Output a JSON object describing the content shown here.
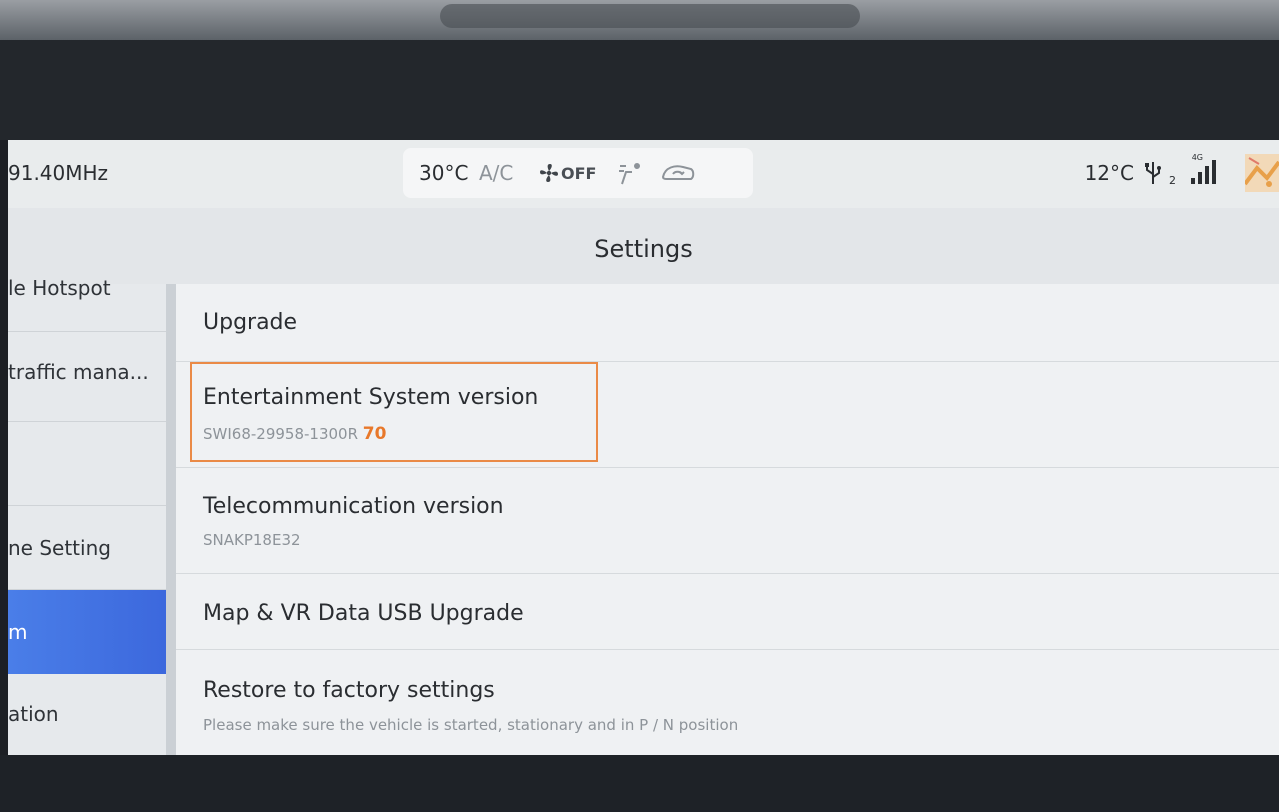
{
  "status_bar": {
    "radio_frequency": "91.40MHz",
    "climate": {
      "cabin_temp": "30°C",
      "ac_label": "A/C",
      "fan_state": "OFF"
    },
    "outside_temp": "12°C",
    "usb_port": "2",
    "network_type": "4G"
  },
  "title_bar": {
    "title": "Settings"
  },
  "sidebar": {
    "items": [
      {
        "label": "le Hotspot"
      },
      {
        "label": "traffic mana..."
      },
      {
        "label": ""
      },
      {
        "label": "ne Setting"
      },
      {
        "label": "m",
        "active": true
      },
      {
        "label": "ation"
      }
    ]
  },
  "settings_list": {
    "rows": [
      {
        "title": "Upgrade",
        "subtitle": ""
      },
      {
        "title": "Entertainment System version",
        "subtitle": "SWI68-29958-1300R",
        "subtitle_highlight": "70"
      },
      {
        "title": "Telecommunication version",
        "subtitle": "SNAKP18E32"
      },
      {
        "title": "Map & VR Data USB Upgrade",
        "subtitle": ""
      },
      {
        "title": "Restore to factory settings",
        "subtitle": "Please make sure the vehicle is started, stationary and in P / N position"
      }
    ]
  },
  "colors": {
    "active_item": "#4a7ee8",
    "highlight_box": "#ea8a46",
    "build_number": "#e8782a"
  }
}
